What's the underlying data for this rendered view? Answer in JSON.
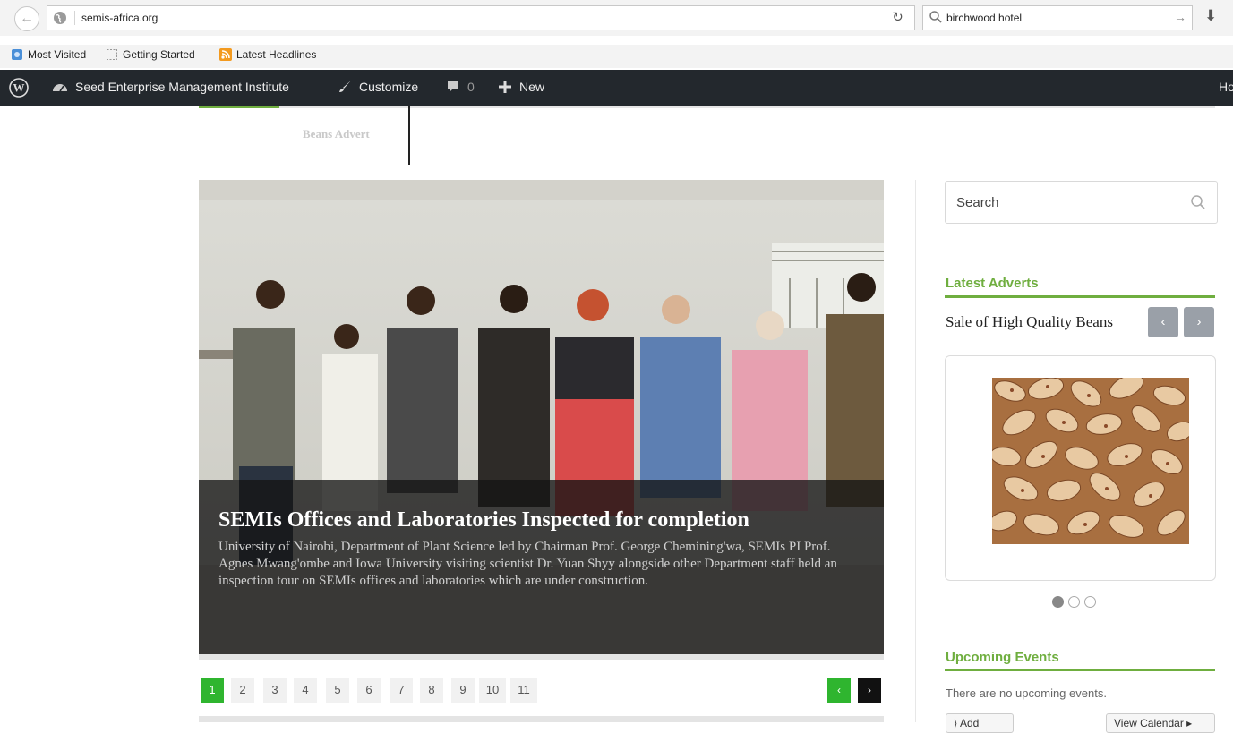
{
  "browser": {
    "url": "semis-africa.org",
    "search_query": "birchwood hotel",
    "bookmarks": [
      "Most Visited",
      "Getting Started",
      "Latest Headlines"
    ]
  },
  "admin_bar": {
    "site_name": "Seed Enterprise Management Institute",
    "customize": "Customize",
    "comments_count": "0",
    "new": "New",
    "right_clipped": "Ho"
  },
  "page": {
    "tab_label": "Beans Advert",
    "slide": {
      "title": "SEMIs Offices and Laboratories Inspected for completion",
      "text": "University of Nairobi, Department of Plant Science led by Chairman Prof. George Chemining'wa, SEMIs PI Prof. Agnes Mwang'ombe and Iowa University visiting scientist Dr. Yuan Shyy alongside other Department staff held an inspection tour on SEMIs offices and laboratories which are under construction."
    },
    "pagination": [
      "1",
      "2",
      "3",
      "4",
      "5",
      "6",
      "7",
      "8",
      "9",
      "10",
      "11"
    ],
    "active_page": "1",
    "prev_arrow": "‹",
    "next_arrow": "›"
  },
  "sidebar": {
    "search_placeholder": "Search",
    "latest_adverts": {
      "title": "Latest Adverts",
      "advert_title": "Sale of High Quality Beans",
      "prev": "‹",
      "next": "›"
    },
    "upcoming_events": {
      "title": "Upcoming Events",
      "empty_text": "There are no upcoming events.",
      "add_label": "Add",
      "view_calendar_label": "View Calendar"
    }
  },
  "colors": {
    "accent_green": "#6fae3f",
    "pager_active": "#2fb52f",
    "admin_bar": "#23282d"
  }
}
